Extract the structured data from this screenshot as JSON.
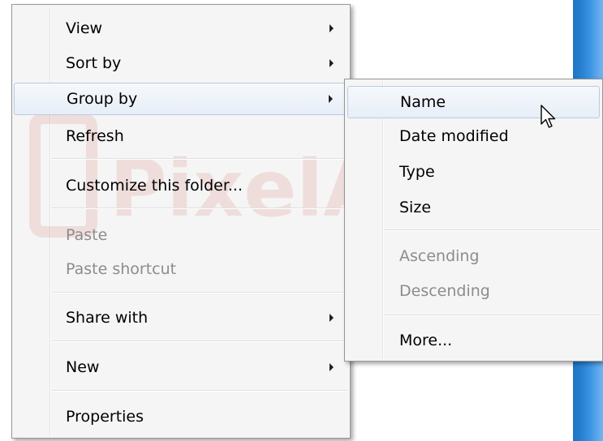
{
  "context_menu": {
    "items": [
      {
        "label": "View",
        "has_submenu": true
      },
      {
        "label": "Sort by",
        "has_submenu": true
      },
      {
        "label": "Group by",
        "has_submenu": true,
        "highlighted": true
      },
      {
        "label": "Refresh"
      },
      {
        "label": "Customize this folder..."
      },
      {
        "label": "Paste",
        "disabled": true
      },
      {
        "label": "Paste shortcut",
        "disabled": true
      },
      {
        "label": "Share with",
        "has_submenu": true
      },
      {
        "label": "New",
        "has_submenu": true
      },
      {
        "label": "Properties"
      }
    ]
  },
  "group_by_submenu": {
    "items": [
      {
        "label": "Name",
        "highlighted": true
      },
      {
        "label": "Date modified"
      },
      {
        "label": "Type"
      },
      {
        "label": "Size"
      },
      {
        "label": "Ascending",
        "disabled": true
      },
      {
        "label": "Descending",
        "disabled": true
      },
      {
        "label": "More..."
      }
    ]
  },
  "watermark": {
    "text": "PixelAmooz.ir",
    "color": "#c0392b"
  },
  "colors": {
    "menu_bg": "#f5f5f5",
    "highlight_border": "#b9cbe4",
    "window_strip": "#2d8be0"
  },
  "icons": {
    "submenu_arrow": "triangle-right",
    "cursor": "arrow-pointer"
  }
}
